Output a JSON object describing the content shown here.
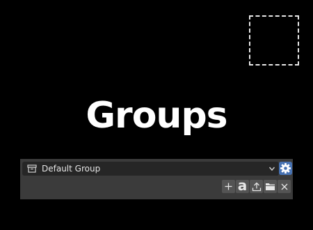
{
  "title": "Groups",
  "group_selector": {
    "selected_value": "Default Group"
  },
  "toolbar": {
    "buttons": [
      {
        "name": "add",
        "icon": "plus-icon"
      },
      {
        "name": "text",
        "icon": "text-a-icon",
        "glyph": "a"
      },
      {
        "name": "export",
        "icon": "upload-icon"
      },
      {
        "name": "open-folder",
        "icon": "folder-icon"
      },
      {
        "name": "remove",
        "icon": "close-icon"
      }
    ]
  },
  "colors": {
    "background": "#000000",
    "panel": "#3b3b3b",
    "accent": "#4772b3"
  }
}
